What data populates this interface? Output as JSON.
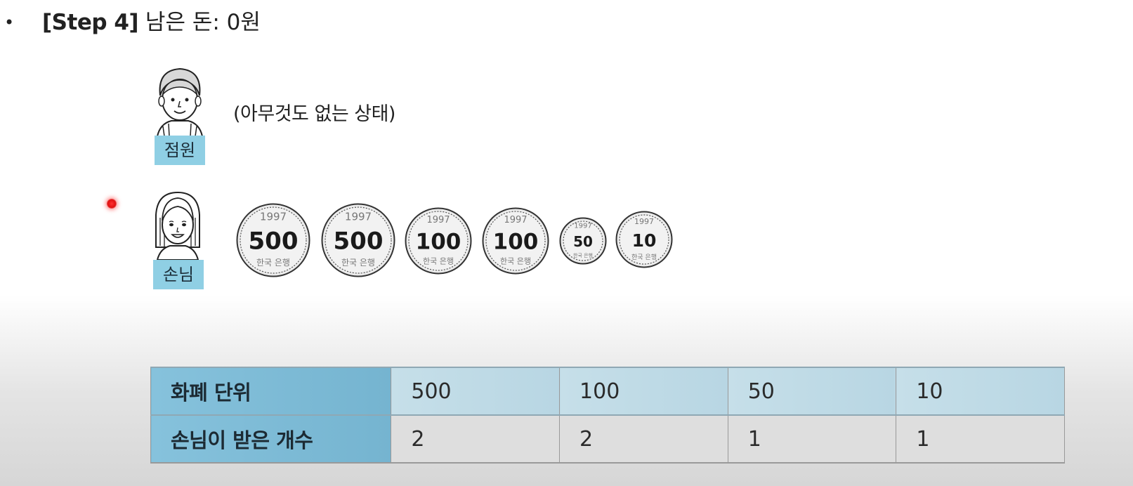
{
  "header": {
    "bullet": "•",
    "step_label": "[Step 4]",
    "remaining_text": "남은 돈: 0원"
  },
  "clerk": {
    "label": "점원",
    "status_text": "(아무것도 없는 상태)"
  },
  "customer": {
    "label": "손님",
    "coins": [
      {
        "value": "500",
        "year": "1997",
        "issuer": "한국 은행"
      },
      {
        "value": "500",
        "year": "1997",
        "issuer": "한국 은행"
      },
      {
        "value": "100",
        "year": "1997",
        "issuer": "한국 은행"
      },
      {
        "value": "100",
        "year": "1997",
        "issuer": "한국 은행"
      },
      {
        "value": "50",
        "year": "1997",
        "issuer": "한국 은행"
      },
      {
        "value": "10",
        "year": "1997",
        "issuer": "한국 은행"
      }
    ]
  },
  "table": {
    "rows": [
      {
        "header": "화폐 단위",
        "cells": [
          "500",
          "100",
          "50",
          "10"
        ]
      },
      {
        "header": "손님이 받은 개수",
        "cells": [
          "2",
          "2",
          "1",
          "1"
        ]
      }
    ]
  },
  "colors": {
    "name_tag": "#8fcfe4",
    "table_header": "#7dbcd7",
    "pointer": "#e01010"
  }
}
